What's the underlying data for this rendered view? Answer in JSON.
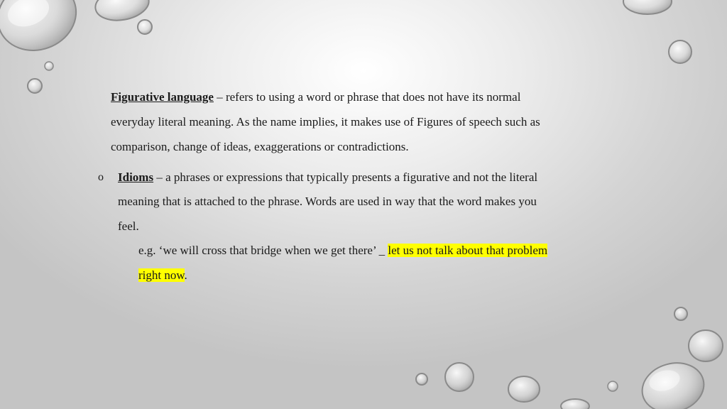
{
  "slide": {
    "definition": {
      "term": "Figurative language",
      "line1_rest": " – refers to using a word or phrase that does not have its normal",
      "line2": "everyday literal meaning. As the name implies, it makes use of Figures of speech such as",
      "line3": "comparison, change of ideas, exaggerations or contradictions."
    },
    "idioms": {
      "bullet": "o",
      "term": "Idioms",
      "line1_rest": " – a phrases or expressions that typically presents a figurative and not the literal",
      "line2": "meaning that is attached to the phrase. Words are used in way that the word makes you",
      "line3": "feel."
    },
    "example": {
      "prefix": "e.g. ‘we will cross that bridge when we get there’ _ ",
      "highlight1": "let us not talk about that problem ",
      "highlight2": "right now",
      "suffix": "."
    },
    "colors": {
      "highlight": "#ffff00",
      "text": "#1a1a1a"
    }
  }
}
